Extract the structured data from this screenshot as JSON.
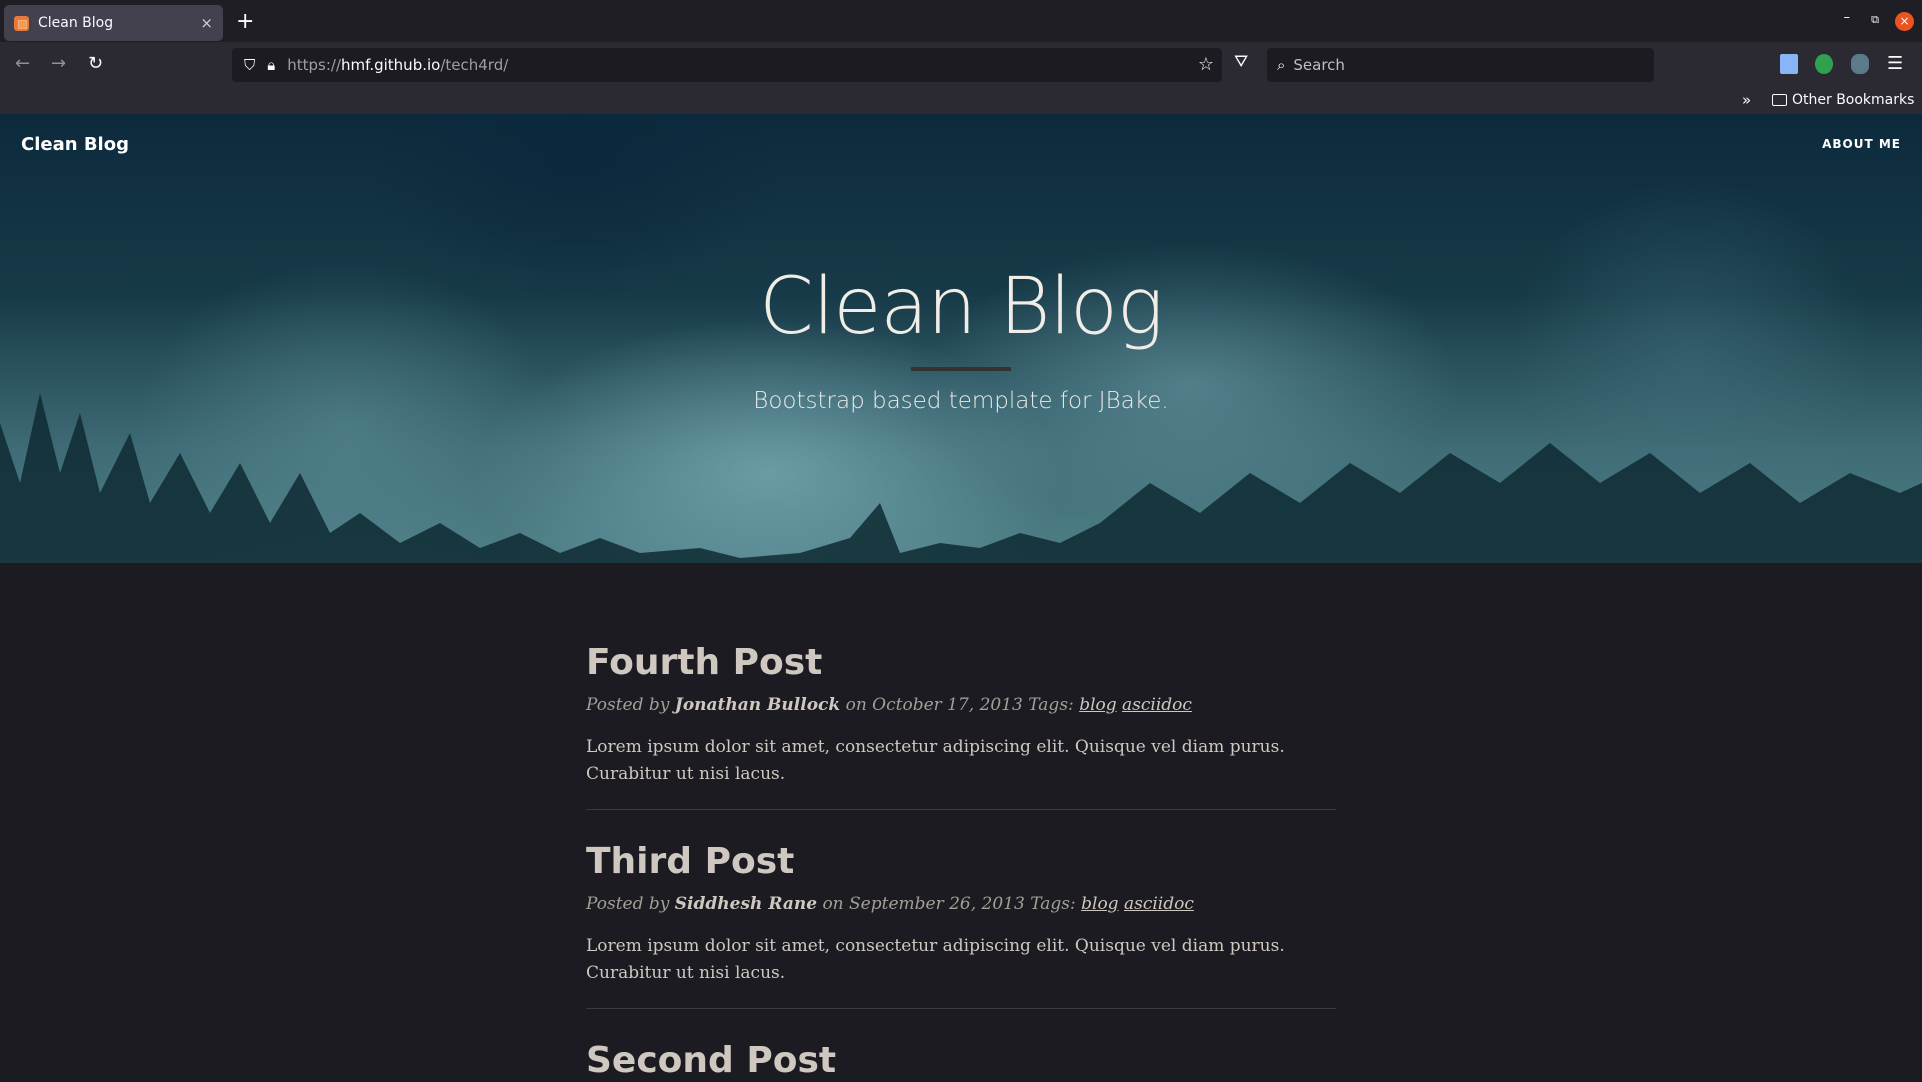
{
  "browser": {
    "tab": {
      "title": "Clean Blog",
      "close": "×"
    },
    "new_tab": "+",
    "window_controls": {
      "minimize": "–",
      "restore": "⧉",
      "close": "×"
    },
    "nav": {
      "back": "←",
      "forward": "→",
      "reload": "↻"
    },
    "url": {
      "scheme": "https://",
      "host": "hmf.github.io",
      "path": "/tech4rd/"
    },
    "search_placeholder": "Search",
    "bookmarks": {
      "overflow": "»",
      "other": "Other Bookmarks"
    }
  },
  "site": {
    "brand": "Clean Blog",
    "nav": [
      {
        "label": "ABOUT ME"
      }
    ],
    "hero": {
      "title": "Clean Blog",
      "subtitle": "Bootstrap based template for JBake."
    }
  },
  "posts": [
    {
      "title": "Fourth Post",
      "posted_by": "Posted by",
      "author": "Jonathan Bullock",
      "on": "on",
      "date": "October 17, 2013",
      "tags_label": "Tags:",
      "tags": [
        "blog",
        "asciidoc"
      ],
      "excerpt": "Lorem ipsum dolor sit amet, consectetur adipiscing elit. Quisque vel diam purus. Curabitur ut nisi lacus."
    },
    {
      "title": "Third Post",
      "posted_by": "Posted by",
      "author": "Siddhesh Rane",
      "on": "on",
      "date": "September 26, 2013",
      "tags_label": "Tags:",
      "tags": [
        "blog",
        "asciidoc"
      ],
      "excerpt": "Lorem ipsum dolor sit amet, consectetur adipiscing elit. Quisque vel diam purus. Curabitur ut nisi lacus."
    },
    {
      "title": "Second Post"
    }
  ]
}
